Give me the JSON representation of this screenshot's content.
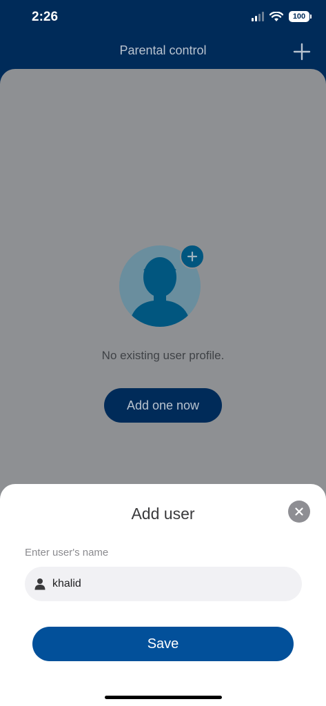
{
  "status_bar": {
    "time": "2:26",
    "battery": "100",
    "icons": [
      "signal-icon",
      "wifi-icon",
      "battery-icon"
    ]
  },
  "header": {
    "title": "Parental control",
    "add_icon": "plus-icon"
  },
  "empty_state": {
    "message": "No existing user profile.",
    "cta_label": "Add one now",
    "avatar_icon": "user-avatar-icon",
    "avatar_add_icon": "plus-icon"
  },
  "dialog": {
    "title": "Add user",
    "close_icon": "close-icon",
    "field_label": "Enter user's name",
    "name_value": "khalid",
    "input_icon": "person-icon",
    "save_label": "Save"
  },
  "colors": {
    "header_bg": "#002b59",
    "overlay_gray": "#8e9093",
    "primary_button": "#02509a",
    "avatar_bg": "#0a6fa0"
  }
}
